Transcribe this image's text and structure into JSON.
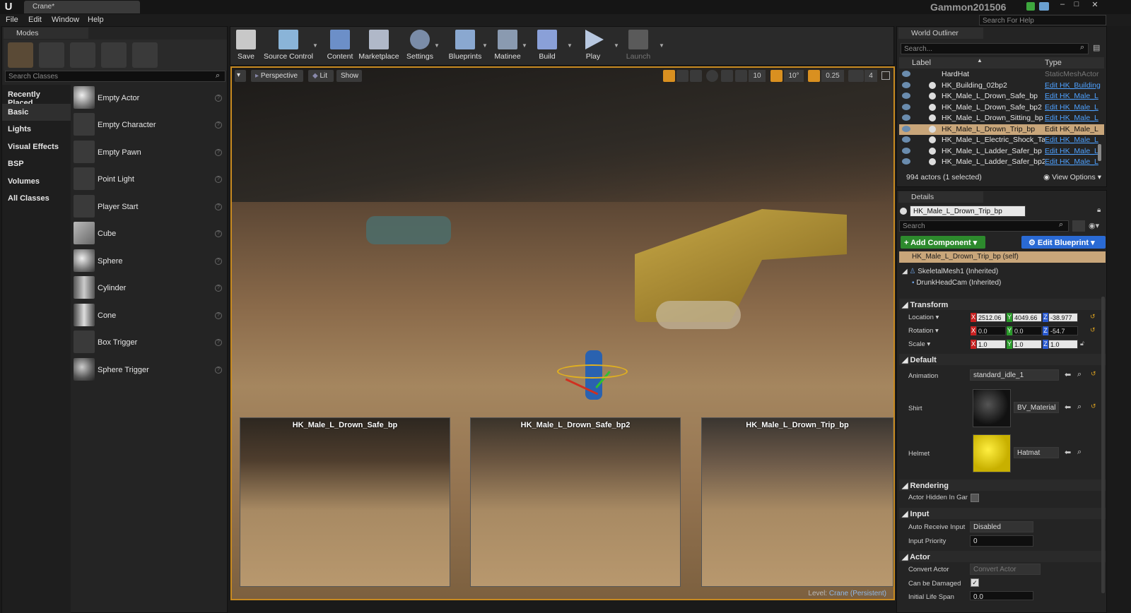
{
  "window": {
    "tab_title": "Crane*",
    "user": "Gammon201506",
    "search_help_placeholder": "Search For Help"
  },
  "menu": [
    "File",
    "Edit",
    "Window",
    "Help"
  ],
  "modes": {
    "tab": "Modes",
    "search_placeholder": "Search Classes",
    "categories": [
      "Recently Placed",
      "Basic",
      "Lights",
      "Visual Effects",
      "BSP",
      "Volumes",
      "All Classes"
    ],
    "selected_category": "Basic",
    "items": [
      "Empty Actor",
      "Empty Character",
      "Empty Pawn",
      "Point Light",
      "Player Start",
      "Cube",
      "Sphere",
      "Cylinder",
      "Cone",
      "Box Trigger",
      "Sphere Trigger"
    ]
  },
  "toolbar": [
    "Save",
    "Source Control",
    "Content",
    "Marketplace",
    "Settings",
    "Blueprints",
    "Matinee",
    "Build",
    "Play",
    "Launch"
  ],
  "viewport": {
    "perspective": "Perspective",
    "lit": "Lit",
    "show": "Show",
    "grid": "10",
    "angle": "10°",
    "scale": "0.25",
    "cam_speed": "4",
    "level_label": "Level:",
    "level_name": "Crane (Persistent)",
    "subviews": [
      "HK_Male_L_Drown_Safe_bp",
      "HK_Male_L_Drown_Safe_bp2",
      "HK_Male_L_Drown_Trip_bp"
    ]
  },
  "outliner": {
    "tab": "World Outliner",
    "search_placeholder": "Search...",
    "col_label": "Label",
    "col_type": "Type",
    "rows": [
      {
        "name": "HardHat",
        "type": "StaticMeshActor"
      },
      {
        "name": "HK_Building_02bp2",
        "type": "Edit HK_Building"
      },
      {
        "name": "HK_Male_L_Drown_Safe_bp",
        "type": "Edit HK_Male_L"
      },
      {
        "name": "HK_Male_L_Drown_Safe_bp2",
        "type": "Edit HK_Male_L"
      },
      {
        "name": "HK_Male_L_Drown_Sitting_bp",
        "type": "Edit HK_Male_L"
      },
      {
        "name": "HK_Male_L_Drown_Trip_bp",
        "type": "Edit HK_Male_L"
      },
      {
        "name": "HK_Male_L_Electric_Shock_Talking",
        "type": "Edit HK_Male_L"
      },
      {
        "name": "HK_Male_L_Ladder_Safer_bp",
        "type": "Edit HK_Male_L"
      },
      {
        "name": "HK_Male_L_Ladder_Safer_bp2",
        "type": "Edit HK_Male_L"
      }
    ],
    "selected_index": 5,
    "actor_count": "994 actors (1 selected)",
    "view_options": "View Options"
  },
  "details": {
    "tab": "Details",
    "name": "HK_Male_L_Drown_Trip_bp",
    "search_placeholder": "Search",
    "add_component": "+ Add Component",
    "edit_blueprint": "Edit Blueprint",
    "self_row": "HK_Male_L_Drown_Trip_bp (self)",
    "components": [
      "SkeletalMesh1 (Inherited)",
      "DrunkHeadCam (Inherited)"
    ],
    "transform": {
      "header": "Transform",
      "location_label": "Location",
      "location": [
        "2512.06",
        "4049.66",
        "-38.977"
      ],
      "rotation_label": "Rotation",
      "rotation": [
        "0.0",
        "0.0",
        "-54.7"
      ],
      "scale_label": "Scale",
      "scale": [
        "1.0",
        "1.0",
        "1.0"
      ]
    },
    "default": {
      "header": "Default",
      "animation_label": "Animation",
      "animation": "standard_idle_1",
      "shirt_label": "Shirt",
      "shirt": "BV_Material",
      "helmet_label": "Helmet",
      "helmet": "Hatmat"
    },
    "rendering": {
      "header": "Rendering",
      "actor_hidden_label": "Actor Hidden In Game"
    },
    "input": {
      "header": "Input",
      "auto_receive_label": "Auto Receive Input",
      "auto_receive": "Disabled",
      "priority_label": "Input Priority",
      "priority": "0"
    },
    "actor": {
      "header": "Actor",
      "convert_label": "Convert Actor",
      "convert": "Convert Actor",
      "damaged_label": "Can be Damaged",
      "life_label": "Initial Life Span",
      "life": "0.0"
    }
  },
  "colors": {
    "accent_blue": "#2a6ad4",
    "add_green": "#2d8a2d",
    "selected_row": "#c9a67a",
    "link": "#4ea1ff"
  }
}
